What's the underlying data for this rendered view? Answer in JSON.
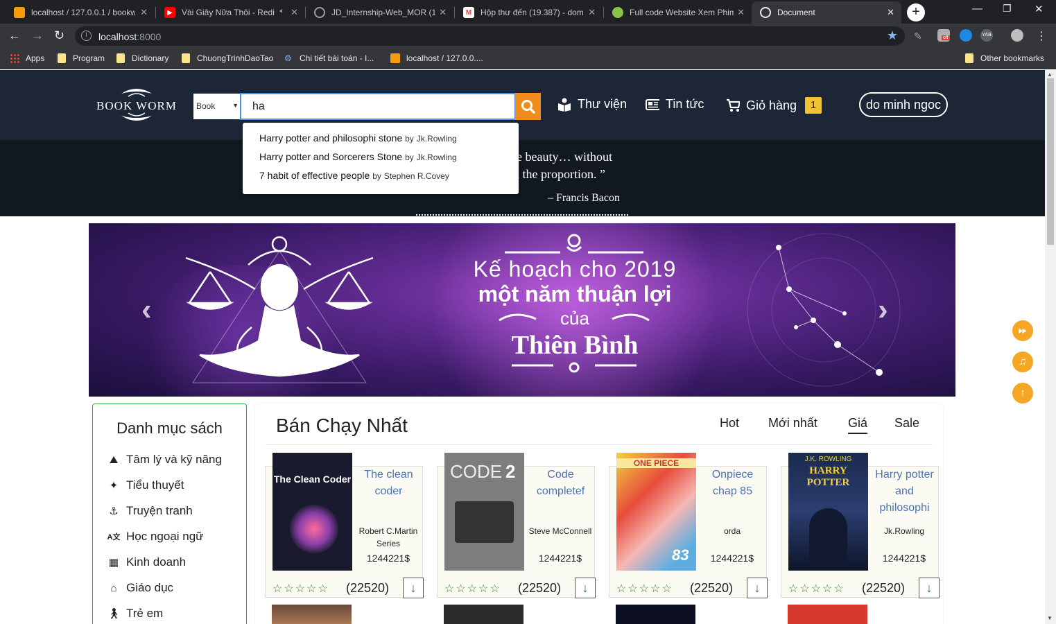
{
  "browser": {
    "tabs": [
      {
        "title": "localhost / 127.0.0.1 / bookw",
        "icon": "phpmyadmin-icon",
        "color": "#f89c0e"
      },
      {
        "title": "Vài Giây Nữa Thôi - Redi",
        "icon": "youtube-icon",
        "color": "#ff0000"
      },
      {
        "title": "JD_Internship-Web_MOR (1)",
        "icon": "globe-icon",
        "color": "#9aa0a6"
      },
      {
        "title": "Hộp thư đến (19.387) - dom",
        "icon": "gmail-icon",
        "color": "#ea4335"
      },
      {
        "title": "Full code Website Xem Phim",
        "icon": "site-icon",
        "color": "#8bc34a"
      },
      {
        "title": "Document",
        "icon": "globe-icon",
        "color": "#9aa0a6"
      }
    ],
    "url_host": "localhost",
    "url_port": ":8000",
    "bookmarks": [
      "Apps",
      "Program",
      "Dictionary",
      "ChuongTrinhDaoTao",
      "Chi tiết bài toán - I...",
      "localhost / 127.0.0....",
      "Other bookmarks"
    ]
  },
  "header": {
    "logo_text": "BOOK WORM",
    "search_type": "Book",
    "search_value": "ha",
    "nav": {
      "library": "Thư viện",
      "news": "Tin tức",
      "cart": "Giỏ hàng",
      "cart_count": "1"
    },
    "user": "do minh ngoc"
  },
  "quote": {
    "line1": "te beauty… without",
    "line2": "n the proportion. ”",
    "author": "– Francis Bacon"
  },
  "autocomplete": [
    {
      "title": "Harry potter and philosophi stone",
      "by": "by",
      "author": "Jk.Rowling"
    },
    {
      "title": "Harry potter and Sorcerers Stone",
      "by": "by",
      "author": "Jk.Rowling"
    },
    {
      "title": "7 habit of effective people",
      "by": "by",
      "author": "Stephen R.Covey"
    }
  ],
  "banner": {
    "line1": "Kế hoạch cho 2019",
    "line2": "một năm thuận lợi",
    "line3": "của",
    "line4": "Thiên Bình"
  },
  "sidebar": {
    "title": "Danh mục sách",
    "categories": [
      "Tâm lý và kỹ năng",
      "Tiểu thuyết",
      "Truyện tranh",
      "Học ngoại ngữ",
      "Kinh doanh",
      "Giáo dục",
      "Trẻ em"
    ]
  },
  "products": {
    "title": "Bán Chạy Nhất",
    "tabs": [
      "Hot",
      "Mới nhất",
      "Giá",
      "Sale"
    ],
    "items": [
      {
        "title": "The clean coder",
        "author": "Robert C.Martin Series",
        "price": "1244221$",
        "count": "(22520)",
        "cover_text": "The Clean Coder"
      },
      {
        "title": "Code completef",
        "author": "Steve McConnell",
        "price": "1244221$",
        "count": "(22520)",
        "cover_text": "CODE"
      },
      {
        "title": "Onpiece chap 85",
        "author": "orda",
        "price": "1244221$",
        "count": "(22520)",
        "cover_text": "ONE PIECE"
      },
      {
        "title": "Harry potter and philosophi",
        "author": "Jk.Rowling",
        "price": "1244221$",
        "count": "(22520)",
        "cover_text": "HARRY POTTER"
      }
    ]
  },
  "colors": {
    "header_bg": "#1c2637",
    "accent_orange": "#ef8c1c",
    "badge_yellow": "#f1c232",
    "link_blue": "#4a73b5",
    "star_green": "#2e8b2e"
  }
}
